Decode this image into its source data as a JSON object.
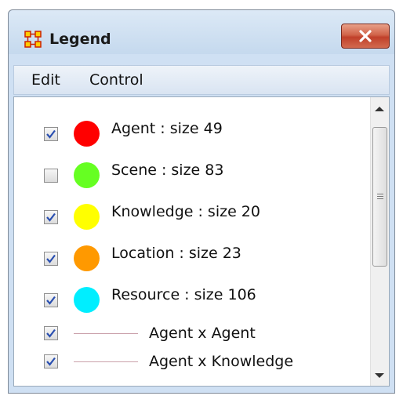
{
  "window": {
    "title": "Legend"
  },
  "menu": {
    "edit": "Edit",
    "control": "Control"
  },
  "nodes": [
    {
      "label": "Agent : size 49",
      "checked": true,
      "color": "#ff0000"
    },
    {
      "label": "Scene : size 83",
      "checked": false,
      "color": "#66ff22"
    },
    {
      "label": "Knowledge : size 20",
      "checked": true,
      "color": "#ffff00"
    },
    {
      "label": "Location : size 23",
      "checked": true,
      "color": "#ff9900"
    },
    {
      "label": "Resource : size 106",
      "checked": true,
      "color": "#00eeff"
    }
  ],
  "edges": [
    {
      "label": "Agent x Agent",
      "checked": true
    },
    {
      "label": "Agent x Knowledge",
      "checked": true
    }
  ]
}
